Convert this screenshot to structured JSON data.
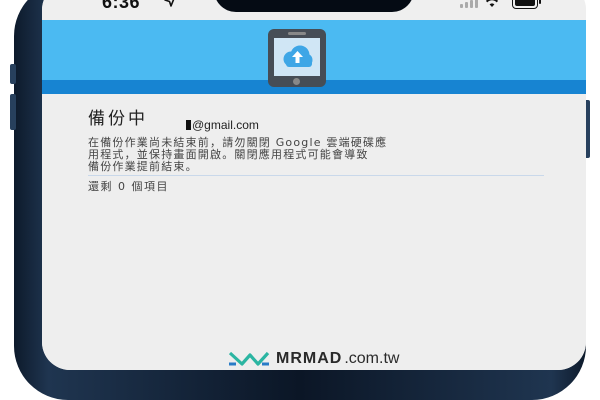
{
  "status_bar": {
    "time": "6:36"
  },
  "backup": {
    "title": "備份中",
    "account": "@gmail.com",
    "description_lines": [
      "在備份作業尚未結束前，請勿關閉 Google 雲端硬碟應",
      "用程式，並保持畫面開啟。關閉應用程式可能會導致",
      "備份作業提前結束。"
    ],
    "remaining": "還剩 0 個項目"
  },
  "watermark": {
    "brand": "MRMAD",
    "domain": ".com.tw"
  },
  "icons": {
    "hero": "phone-cloud-upload-icon",
    "location": "location-arrow-icon",
    "signal": "cellular-signal-icon",
    "wifi": "wifi-icon",
    "battery": "battery-icon",
    "logo": "mrmad-logo-icon"
  },
  "colors": {
    "hero_light": "#4bbaf2",
    "hero_dark": "#1784d2",
    "background": "#eeeeee",
    "frame": "#0b1626"
  }
}
